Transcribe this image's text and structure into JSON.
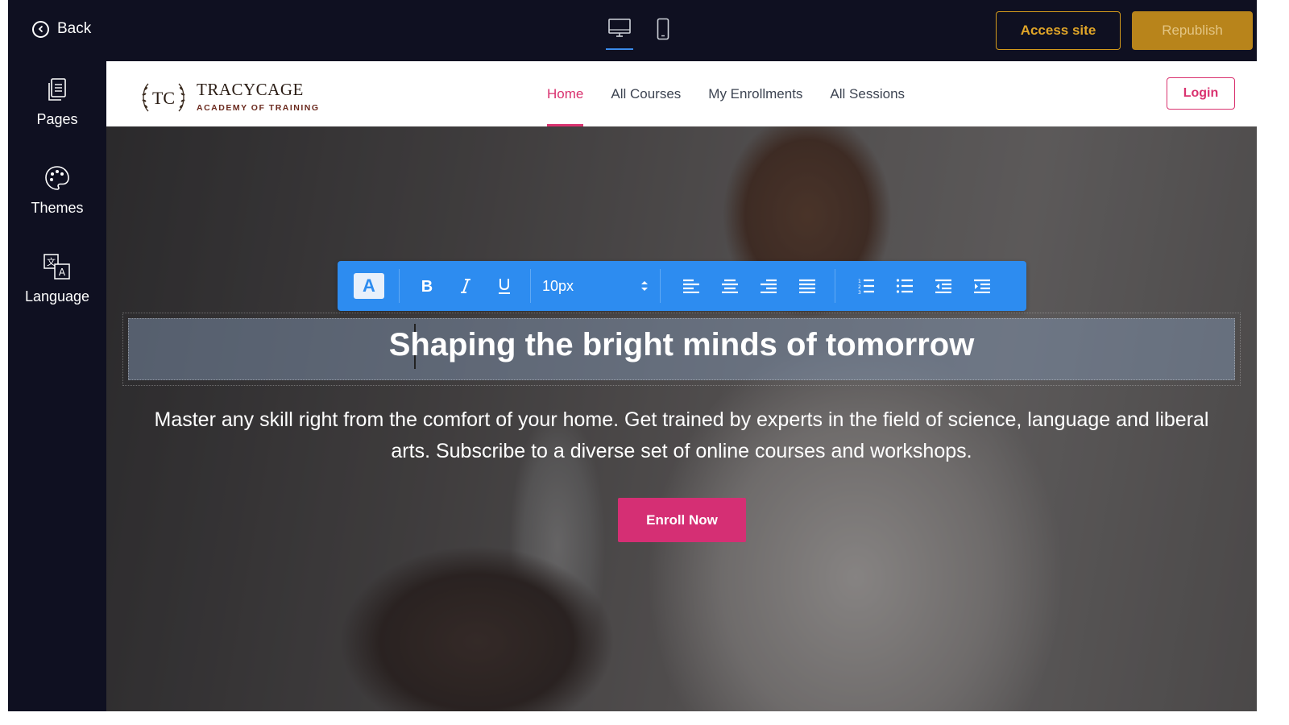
{
  "topbar": {
    "back_label": "Back",
    "access_label": "Access site",
    "republish_label": "Republish"
  },
  "sidebar": {
    "items": [
      {
        "label": "Pages",
        "icon": "pages-icon"
      },
      {
        "label": "Themes",
        "icon": "palette-icon"
      },
      {
        "label": "Language",
        "icon": "translate-icon"
      }
    ]
  },
  "site": {
    "brand": "TRACYCAGE",
    "brand_sub": "ACADEMY OF TRAINING",
    "logo_mark": "TC",
    "nav": [
      "Home",
      "All Courses",
      "My Enrollments",
      "All Sessions"
    ],
    "active_nav": "Home",
    "login_label": "Login"
  },
  "toolbar": {
    "font_size": "10px"
  },
  "hero": {
    "headline": "Shaping the bright minds of tomorrow",
    "subtext": "Master any skill right from the comfort of your home. Get trained by experts in the field of science, language and liberal arts. Subscribe to a diverse set of online courses and workshops.",
    "cta_label": "Enroll Now"
  },
  "colors": {
    "accent": "#d9326f",
    "toolbar": "#2d8cf0",
    "dark_bg": "#0f1021",
    "gold": "#d39a1c"
  }
}
